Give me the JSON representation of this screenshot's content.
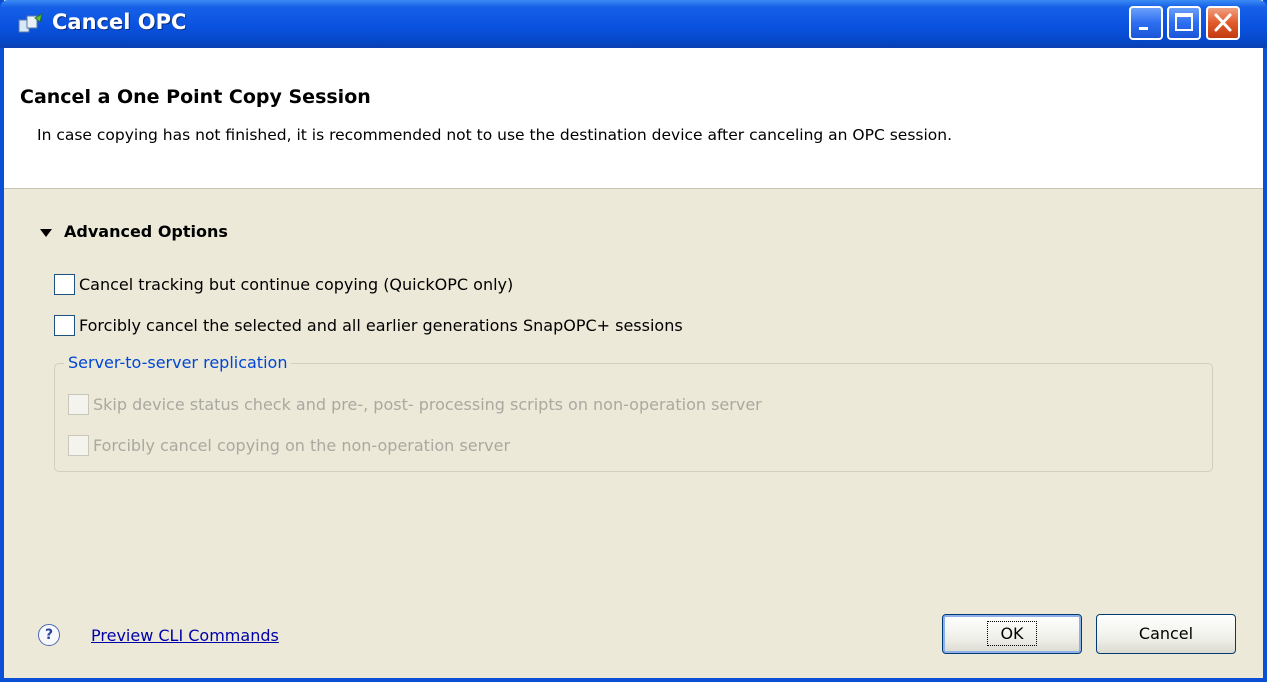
{
  "window": {
    "title": "Cancel OPC",
    "controls": {
      "minimize": "minimize-icon",
      "maximize": "maximize-icon",
      "close": "close-icon"
    }
  },
  "header": {
    "title": "Cancel a One Point Copy Session",
    "message": "In case copying has not finished, it is recommended not to use the destination device after canceling an OPC session."
  },
  "advanced": {
    "label": "Advanced Options",
    "options": [
      {
        "label": "Cancel tracking but continue copying (QuickOPC only)",
        "checked": false,
        "enabled": true
      },
      {
        "label": "Forcibly cancel the selected and all earlier generations SnapOPC+ sessions",
        "checked": false,
        "enabled": true
      }
    ]
  },
  "replication": {
    "label": "Server-to-server replication",
    "options": [
      {
        "label": "Skip device status check and pre-, post- processing scripts on non-operation server",
        "checked": false,
        "enabled": false
      },
      {
        "label": "Forcibly cancel copying on the non-operation server",
        "checked": false,
        "enabled": false
      }
    ]
  },
  "footer": {
    "help_icon": "help-icon",
    "preview_link": "Preview CLI Commands",
    "ok_label": "OK",
    "cancel_label": "Cancel"
  },
  "colors": {
    "titlebar": "#0a52e0",
    "dialog_bg": "#ece9d8",
    "group_label": "#0046d5",
    "link": "#0000aa"
  }
}
